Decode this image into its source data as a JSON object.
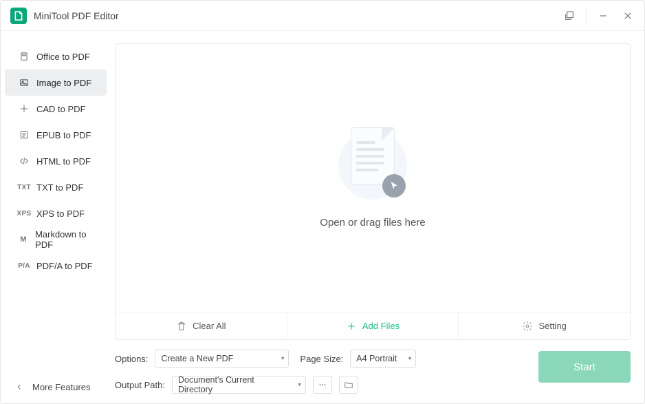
{
  "titlebar": {
    "title": "MiniTool PDF Editor"
  },
  "sidebar": {
    "items": [
      {
        "label": "Office to PDF"
      },
      {
        "label": "Image to PDF"
      },
      {
        "label": "CAD to PDF"
      },
      {
        "label": "EPUB to PDF"
      },
      {
        "label": "HTML to PDF"
      },
      {
        "label": "TXT to PDF"
      },
      {
        "label": "XPS to PDF"
      },
      {
        "label": "Markdown to PDF"
      },
      {
        "label": "PDF/A to PDF"
      }
    ],
    "selected_index": 1,
    "more_label": "More Features"
  },
  "dropzone": {
    "hint": "Open or drag files here"
  },
  "actionbar": {
    "clear_label": "Clear All",
    "add_label": "Add Files",
    "setting_label": "Setting"
  },
  "options": {
    "options_label": "Options:",
    "options_value": "Create a New PDF",
    "pagesize_label": "Page Size:",
    "pagesize_value": "A4 Portrait",
    "outputpath_label": "Output Path:",
    "outputpath_value": "Document's Current Directory"
  },
  "start": {
    "label": "Start"
  },
  "icon_badges": {
    "txt": "TXT",
    "xps": "XPS",
    "markdown": "M",
    "pdfa": "P/A"
  }
}
